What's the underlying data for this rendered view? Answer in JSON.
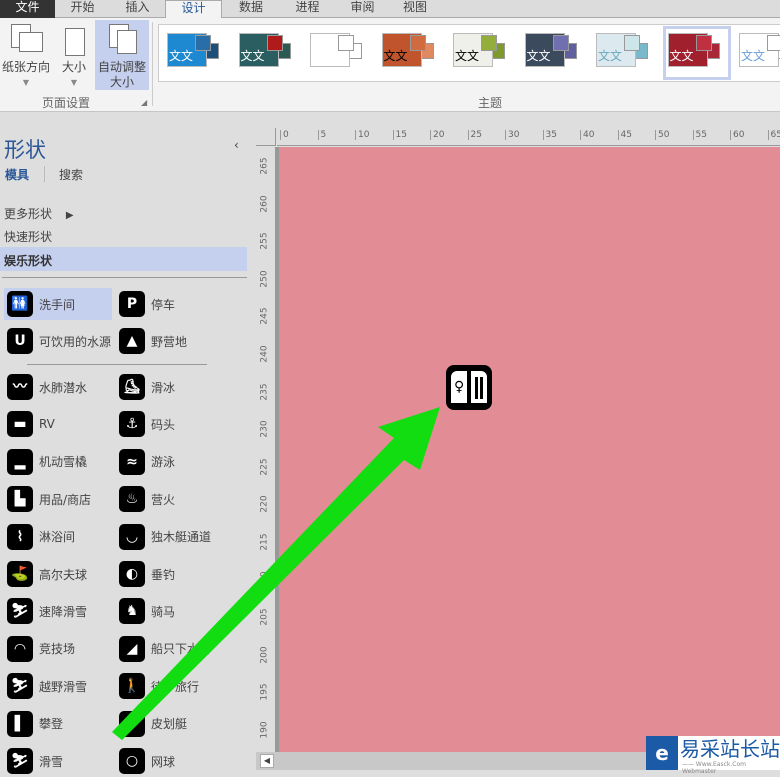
{
  "tabs": [
    "文件",
    "开始",
    "插入",
    "设计",
    "数据",
    "进程",
    "审阅",
    "视图"
  ],
  "active_tab": "设计",
  "ribbon": {
    "page_setup": {
      "orientation": "纸张方向",
      "size": "大小",
      "autofit_line1": "自动调整",
      "autofit_line2": "大小",
      "group_label": "页面设置"
    },
    "themes": {
      "group_label": "主题",
      "sample_text": "文文",
      "items": [
        {
          "bg": "#1e88d0",
          "s1": "#2a6ea8",
          "s2": "#1c4f7a",
          "text": "#ffffff"
        },
        {
          "bg": "#2b5e60",
          "s1": "#b01a1a",
          "s2": "#2a5a52",
          "text": "#ffffff"
        },
        {
          "bg": "#ffffff",
          "s1": "#ffffff",
          "s2": "#ffffff",
          "text": "#ffffff"
        },
        {
          "bg": "#c0542c",
          "s1": "#d06a40",
          "s2": "#e08860",
          "text": "#000000"
        },
        {
          "bg": "#f0f0ea",
          "s1": "#94ae3c",
          "s2": "#7e9a2c",
          "text": "#000000"
        },
        {
          "bg": "#3c4a5e",
          "s1": "#7070b0",
          "s2": "#6060a0",
          "text": "#ffffff"
        },
        {
          "bg": "#dce9ee",
          "s1": "#cde6ea",
          "s2": "#7ab8cc",
          "text": "#6aa8c0"
        },
        {
          "bg": "#a0202e",
          "s1": "#c03040",
          "s2": "#a82838",
          "text": "#ffffff",
          "selected": true
        },
        {
          "bg": "#ffffff",
          "s1": "#ffffff",
          "s2": "#ffffff",
          "text": "#6aa0d8"
        }
      ]
    }
  },
  "shapes_panel": {
    "title": "形状",
    "tab_stencil": "模具",
    "tab_search": "搜索",
    "categories": [
      "更多形状",
      "快速形状",
      "娱乐形状"
    ],
    "selected_category": "娱乐形状",
    "items_top": [
      {
        "label": "洗手间",
        "icon": "restroom-icon",
        "glyph": "🚻",
        "selected": true
      },
      {
        "label": "停车",
        "icon": "parking-icon",
        "glyph": "P"
      },
      {
        "label": "可饮用的水源",
        "icon": "drinking-water-icon",
        "glyph": "U"
      },
      {
        "label": "野营地",
        "icon": "campground-icon",
        "glyph": "▲"
      }
    ],
    "items": [
      {
        "label": "水肺潜水",
        "icon": "scuba-icon",
        "glyph": "〰"
      },
      {
        "label": "滑冰",
        "icon": "skating-icon",
        "glyph": "⛸"
      },
      {
        "label": "RV",
        "icon": "rv-icon",
        "glyph": "▬"
      },
      {
        "label": "码头",
        "icon": "anchor-icon",
        "glyph": "⚓"
      },
      {
        "label": "机动雪橇",
        "icon": "snowmobile-icon",
        "glyph": "▂"
      },
      {
        "label": "游泳",
        "icon": "swimming-icon",
        "glyph": "≈"
      },
      {
        "label": "用品/商店",
        "icon": "store-icon",
        "glyph": "▙"
      },
      {
        "label": "营火",
        "icon": "campfire-icon",
        "glyph": "♨"
      },
      {
        "label": "淋浴间",
        "icon": "shower-icon",
        "glyph": "⌇"
      },
      {
        "label": "独木艇通道",
        "icon": "canoe-icon",
        "glyph": "◡"
      },
      {
        "label": "高尔夫球",
        "icon": "golf-icon",
        "glyph": "⛳"
      },
      {
        "label": "垂钓",
        "icon": "fishing-icon",
        "glyph": "◐"
      },
      {
        "label": "速降滑雪",
        "icon": "downhill-ski-icon",
        "glyph": "⛷"
      },
      {
        "label": "骑马",
        "icon": "horse-riding-icon",
        "glyph": "♞"
      },
      {
        "label": "竞技场",
        "icon": "arena-icon",
        "glyph": "◠"
      },
      {
        "label": "船只下水台",
        "icon": "boat-ramp-icon",
        "glyph": "◢"
      },
      {
        "label": "越野滑雪",
        "icon": "cross-country-ski-icon",
        "glyph": "⛷"
      },
      {
        "label": "徒步旅行",
        "icon": "hiking-icon",
        "glyph": "🚶"
      },
      {
        "label": "攀登",
        "icon": "climbing-icon",
        "glyph": "▌"
      },
      {
        "label": "皮划艇",
        "icon": "kayak-icon",
        "glyph": "⌒"
      },
      {
        "label": "滑雪",
        "icon": "ski-icon",
        "glyph": "⛷"
      },
      {
        "label": "网球",
        "icon": "tennis-icon",
        "glyph": "○"
      }
    ]
  },
  "rulers": {
    "horizontal": [
      "0",
      "5",
      "10",
      "15",
      "20",
      "25",
      "30",
      "35",
      "40",
      "45",
      "50",
      "55",
      "60",
      "65"
    ],
    "vertical": [
      "265",
      "260",
      "255",
      "250",
      "245",
      "240",
      "235",
      "230",
      "225",
      "220",
      "215",
      "210",
      "205",
      "200",
      "195",
      "190"
    ]
  },
  "canvas": {
    "background": "#e28d95",
    "arrow_color": "#11dd11"
  },
  "watermark": {
    "name": "易采站长站",
    "url": "—— Www.Easck.Com  Webmaster"
  }
}
